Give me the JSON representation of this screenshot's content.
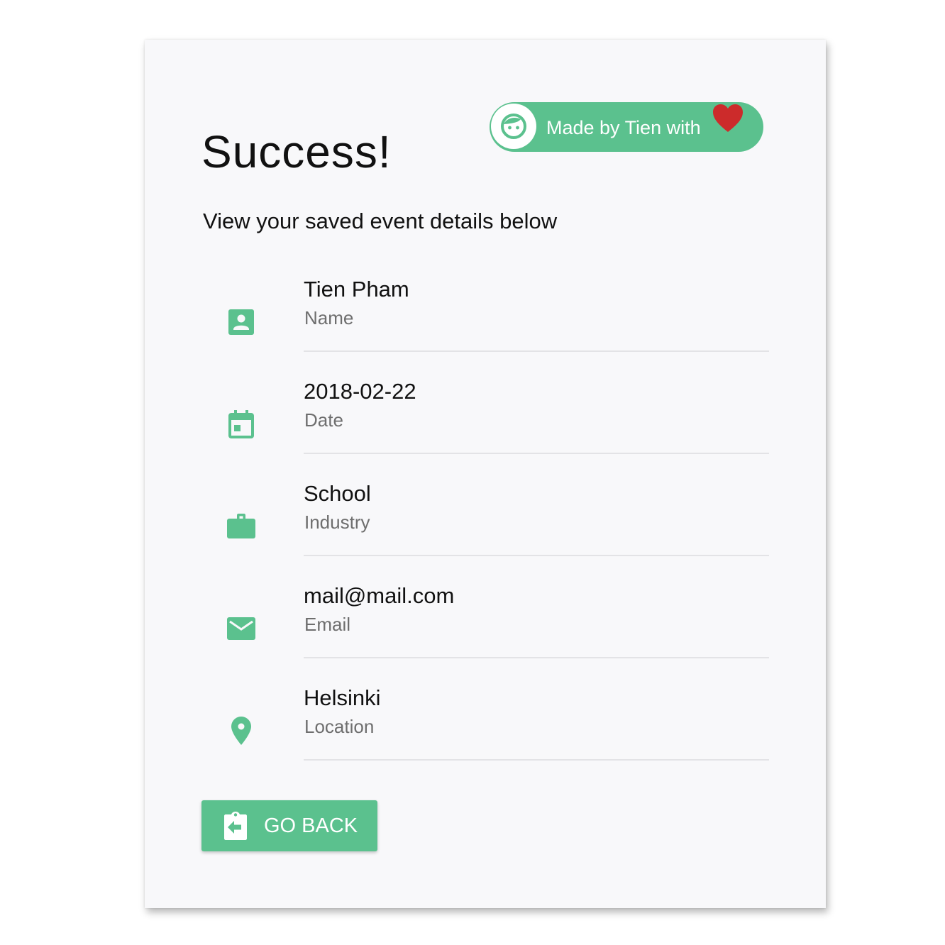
{
  "header": {
    "title": "Success!",
    "subtitle": "View your saved event details below"
  },
  "badge": {
    "label": "Made by Tien with",
    "icon": "face-icon",
    "heart_icon": "heart-icon",
    "heart_color": "#cc2b2b"
  },
  "details": [
    {
      "value": "Tien Pham",
      "caption": "Name",
      "icon": "account-box-icon"
    },
    {
      "value": "2018-02-22",
      "caption": "Date",
      "icon": "calendar-icon"
    },
    {
      "value": "School",
      "caption": "Industry",
      "icon": "briefcase-icon"
    },
    {
      "value": "mail@mail.com",
      "caption": "Email",
      "icon": "mail-icon"
    },
    {
      "value": "Helsinki",
      "caption": "Location",
      "icon": "location-pin-icon"
    }
  ],
  "actions": {
    "go_back_label": "GO BACK",
    "go_back_icon": "assignment-return-icon"
  },
  "colors": {
    "accent": "#5bc18e",
    "card_background": "#f8f8fa",
    "caption_text": "#6e6e6e"
  }
}
